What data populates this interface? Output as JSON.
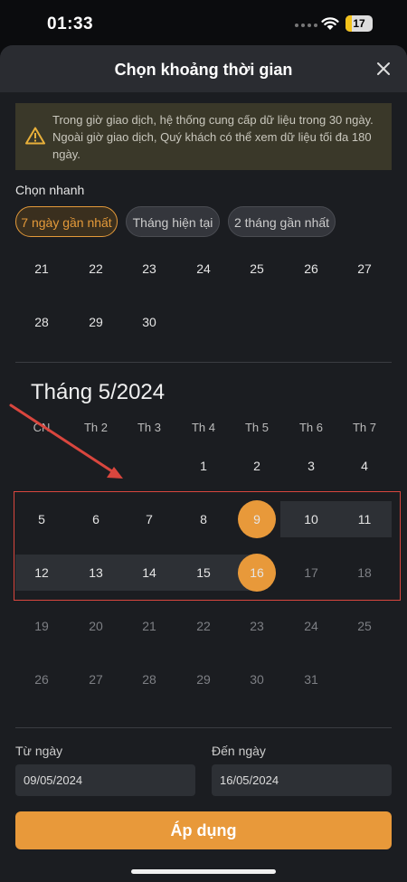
{
  "status_bar": {
    "time": "01:33",
    "battery": "17"
  },
  "header": {
    "title": "Chọn khoảng thời gian",
    "close_icon": "close-icon"
  },
  "notice": {
    "icon": "warning-icon",
    "text": "Trong giờ giao dịch, hệ thống cung cấp dữ liệu trong 30 ngày. Ngoài giờ giao dịch, Quý khách có thể xem dữ liệu tối đa 180 ngày."
  },
  "quick_select": {
    "label": "Chọn nhanh",
    "chips": [
      "7 ngày gần nhất",
      "Tháng hiện tại",
      "2 tháng gần nhất"
    ],
    "active_index": 0
  },
  "prev_month_tail": {
    "row1": [
      "21",
      "22",
      "23",
      "24",
      "25",
      "26",
      "27"
    ],
    "row2": [
      "28",
      "29",
      "30"
    ]
  },
  "calendar": {
    "month_title": "Tháng 5/2024",
    "weekdays": [
      "CN",
      "Th 2",
      "Th 3",
      "Th 4",
      "Th 5",
      "Th 6",
      "Th 7"
    ],
    "week1": [
      "1",
      "2",
      "3",
      "4"
    ],
    "week2": [
      "5",
      "6",
      "7",
      "8",
      "9",
      "10",
      "11"
    ],
    "week3": [
      "12",
      "13",
      "14",
      "15",
      "16",
      "17",
      "18"
    ],
    "week4": [
      "19",
      "20",
      "21",
      "22",
      "23",
      "24",
      "25"
    ],
    "week5": [
      "26",
      "27",
      "28",
      "29",
      "30",
      "31"
    ],
    "range_start": "9",
    "range_end": "16"
  },
  "range": {
    "from_label": "Từ ngày",
    "from_value": "09/05/2024",
    "to_label": "Đến ngày",
    "to_value": "16/05/2024"
  },
  "apply_button": "Áp dụng",
  "colors": {
    "accent": "#e8993a",
    "background": "#1b1d21",
    "annotation": "#d9463e"
  }
}
